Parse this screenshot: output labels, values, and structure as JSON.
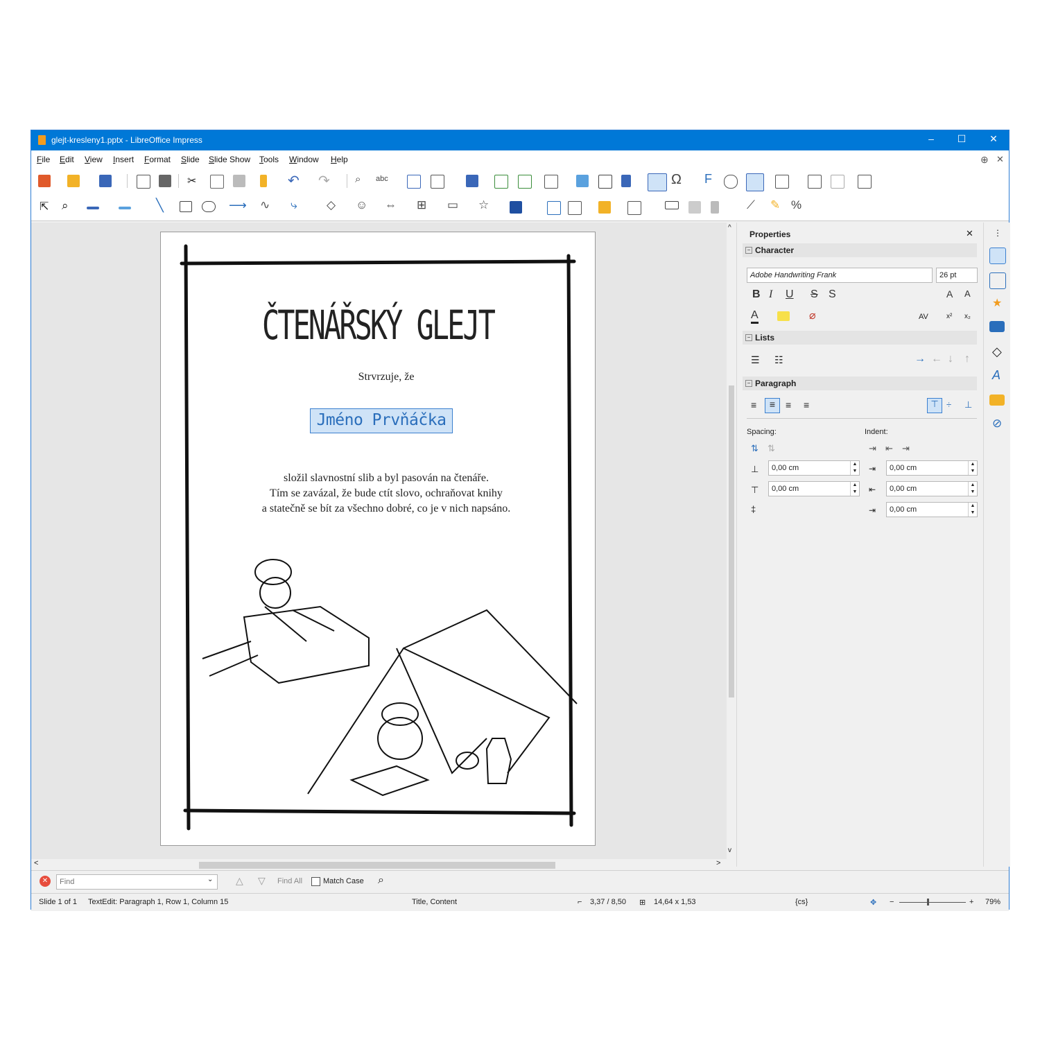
{
  "window": {
    "title": "glejt-kresleny1.pptx - LibreOffice Impress",
    "controls": [
      "–",
      "☐",
      "✕"
    ]
  },
  "menu": [
    "File",
    "Edit",
    "View",
    "Insert",
    "Format",
    "Slide",
    "Slide Show",
    "Tools",
    "Window",
    "Help"
  ],
  "slide": {
    "title": "ČTENÁŘSKÝ GLEJT",
    "subtitle": "Strvrzuje, že",
    "name": "Jméno Prvňáčka",
    "body": [
      "složil slavnostní slib a byl pasován na čtenáře.",
      "Tím se zavázal, že bude ctít slovo, ochraňovat knihy",
      "a statečně se bít za všechno dobré, co je v nich napsáno."
    ]
  },
  "sidebar": {
    "title": "Properties",
    "character": {
      "label": "Character",
      "font": "Adobe Handwriting Frank",
      "size": "26 pt"
    },
    "lists": {
      "label": "Lists"
    },
    "paragraph": {
      "label": "Paragraph"
    },
    "spacing_label": "Spacing:",
    "indent_label": "Indent:",
    "spacing_above": "0,00 cm",
    "spacing_below": "0,00 cm",
    "indent_before": "0,00 cm",
    "indent_after": "0,00 cm",
    "indent_first": "0,00 cm"
  },
  "findbar": {
    "placeholder": "Find",
    "find_all": "Find All",
    "match_case": "Match Case"
  },
  "status": {
    "slide": "Slide 1 of 1",
    "edit": "TextEdit: Paragraph 1, Row 1, Column 15",
    "layout": "Title, Content",
    "position": "3,37 / 8,50",
    "size": "14,64 x 1,53",
    "lang": "{cs}",
    "zoom": "79%"
  },
  "colors": {
    "titlebar": "#0078d7",
    "selection": "#cfe3f7",
    "accent": "#2a6ebb"
  }
}
